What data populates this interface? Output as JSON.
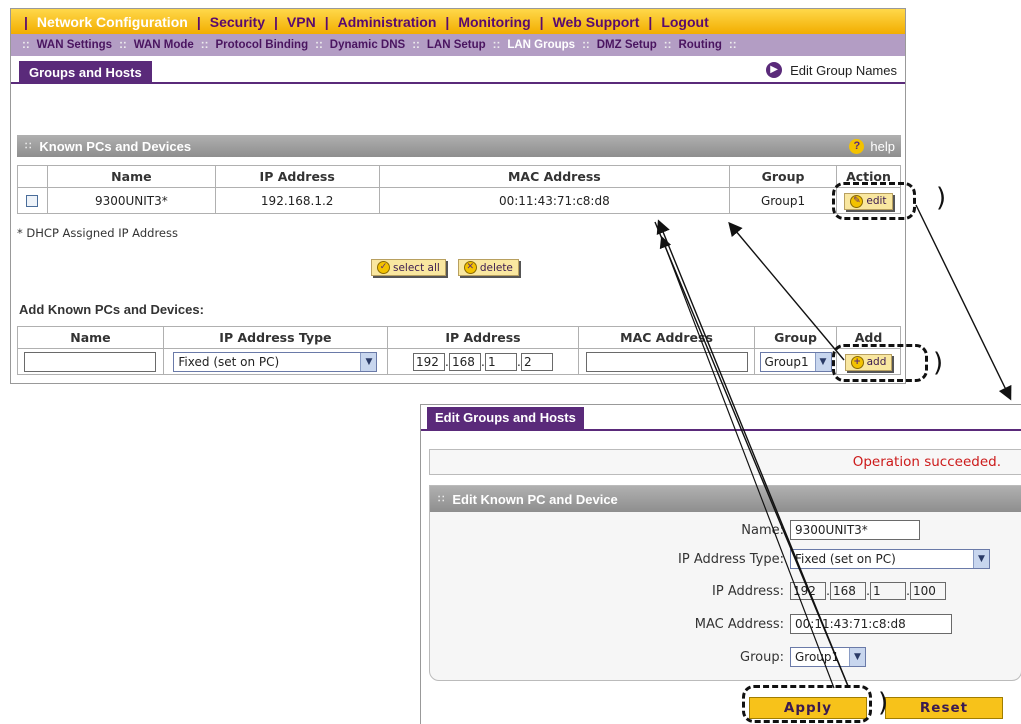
{
  "top_nav": {
    "items": [
      "Network Configuration",
      "Security",
      "VPN",
      "Administration",
      "Monitoring",
      "Web Support",
      "Logout"
    ],
    "active": "Network Configuration"
  },
  "sub_nav": {
    "items": [
      "WAN Settings",
      "WAN Mode",
      "Protocol Binding",
      "Dynamic DNS",
      "LAN Setup",
      "LAN Groups",
      "DMZ Setup",
      "Routing"
    ],
    "active": "LAN Groups"
  },
  "panel1": {
    "tab_label": "Groups and Hosts",
    "edit_group_link": "Edit Group Names",
    "known_section_title": "Known PCs and Devices",
    "help_label": "help",
    "known_table": {
      "headers": [
        "Name",
        "IP Address",
        "MAC Address",
        "Group",
        "Action"
      ],
      "rows": [
        {
          "name": "9300UNIT3*",
          "ip": "192.168.1.2",
          "mac": "00:11:43:71:c8:d8",
          "group": "Group1",
          "action": "edit"
        }
      ]
    },
    "dhcp_note": "* DHCP Assigned IP Address",
    "select_all_label": "select all",
    "delete_label": "delete",
    "add_section_title": "Add Known PCs and Devices:",
    "add_table": {
      "headers": [
        "Name",
        "IP Address Type",
        "IP Address",
        "MAC Address",
        "Group",
        "Add"
      ],
      "name_value": "",
      "ip_type_value": "Fixed (set on PC)",
      "ip_octets": [
        "192",
        "168",
        "1",
        "2"
      ],
      "mac_value": "",
      "group_value": "Group1",
      "add_label": "add"
    }
  },
  "panel2": {
    "tab_label": "Edit Groups and Hosts",
    "status_message": "Operation succeeded.",
    "section_title": "Edit Known PC and Device",
    "fields": {
      "name_label": "Name:",
      "name_value": "9300UNIT3*",
      "ip_type_label": "IP Address Type:",
      "ip_type_value": "Fixed (set on PC)",
      "ip_label": "IP Address:",
      "ip_octets": [
        "192",
        "168",
        "1",
        "100"
      ],
      "mac_label": "MAC Address:",
      "mac_value": "00:11:43:71:c8:d8",
      "group_label": "Group:",
      "group_value": "Group1"
    },
    "apply_label": "Apply",
    "reset_label": "Reset"
  },
  "colors": {
    "nav_gold": "#f2ad00",
    "subnav_lavender": "#b39dc4",
    "brand_purple": "#5a2a7a",
    "status_red": "#cc1a1a"
  }
}
